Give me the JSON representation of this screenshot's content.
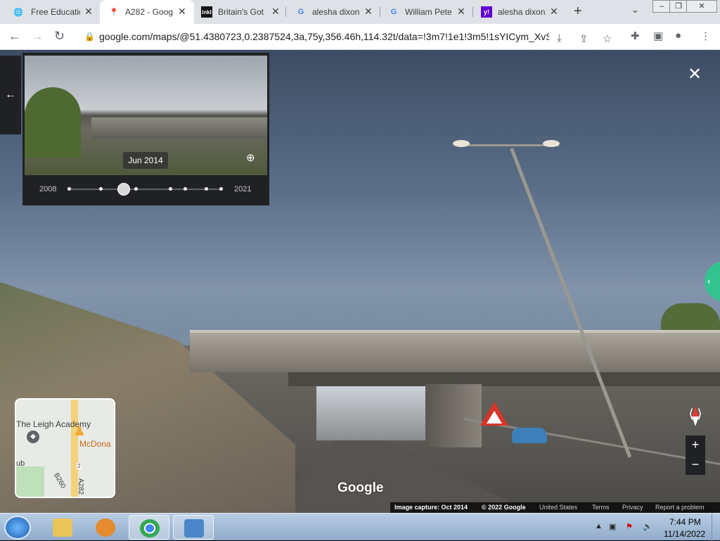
{
  "browser": {
    "tabs": [
      {
        "title": "Free Educatio",
        "icon": "globe-icon"
      },
      {
        "title": "A282 - Goog",
        "icon": "maps-pin-icon"
      },
      {
        "title": "Britain's Got",
        "icon": "inkl-icon"
      },
      {
        "title": "alesha dixon",
        "icon": "google-g-icon"
      },
      {
        "title": "William Pete",
        "icon": "google-g-icon"
      },
      {
        "title": "alesha dixon",
        "icon": "yahoo-icon"
      }
    ],
    "active_tab_index": 1,
    "url": "google.com/maps/@51.4380723,0.2387524,3a,75y,356.46h,114.32t/data=!3m7!1e1!3m5!1sYICym_XvS..."
  },
  "streetview": {
    "timeline": {
      "selected_date": "Jun 2014",
      "start_year": "2008",
      "end_year": "2021"
    },
    "minimap": {
      "place_label": "The Leigh Academy",
      "poi_label": "McDona",
      "area_label": "ub",
      "road_b260": "B260",
      "road_a282": "A282",
      "road_shield": "2"
    },
    "watermark": "Google",
    "footer": {
      "capture": "Image capture: Oct 2014",
      "copyright": "© 2022 Google",
      "region": "United States",
      "terms": "Terms",
      "privacy": "Privacy",
      "report": "Report a problem"
    }
  },
  "taskbar": {
    "time": "7:44 PM",
    "date": "11/14/2022"
  }
}
